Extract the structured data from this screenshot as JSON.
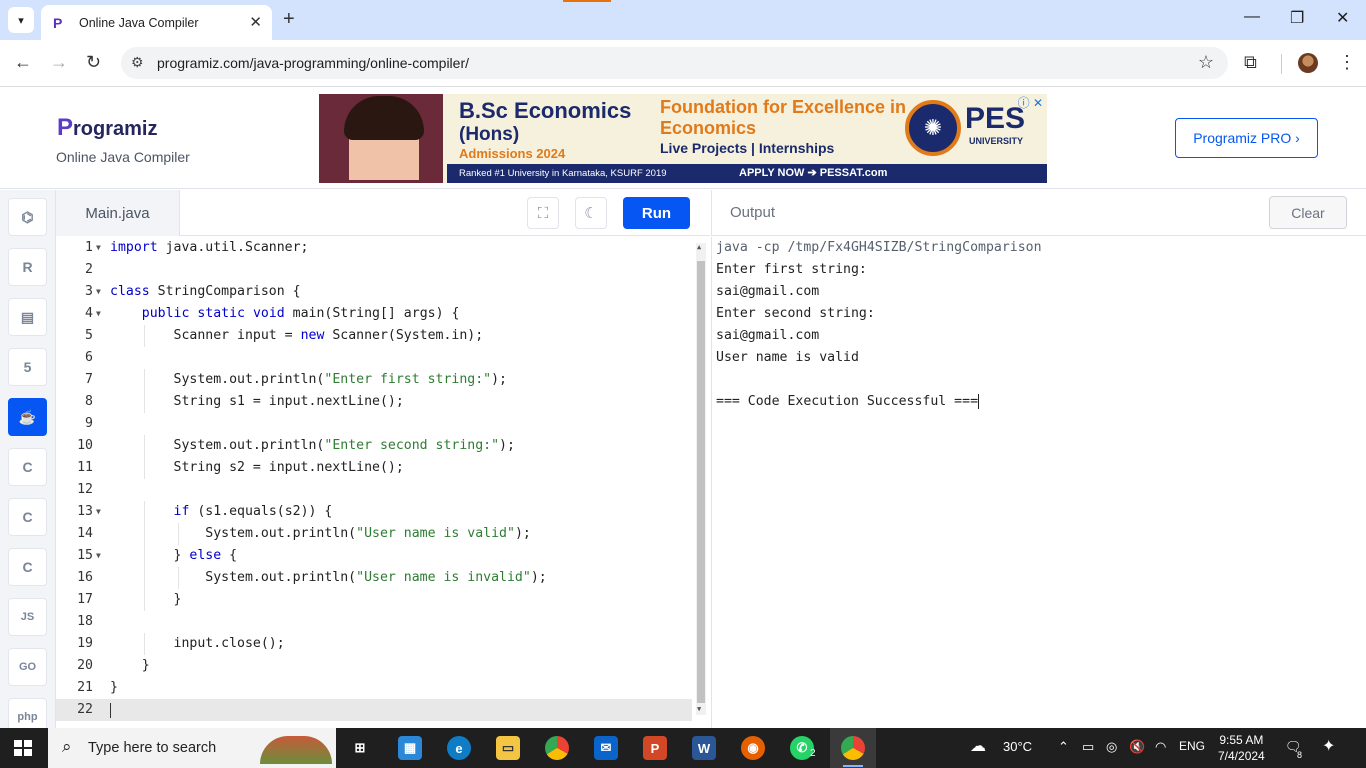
{
  "browser": {
    "tab_title": "Online Java Compiler",
    "url": "programiz.com/java-programming/online-compiler/"
  },
  "site": {
    "logo_first": "P",
    "logo_rest": "rogramiz",
    "subtitle": "Online Java Compiler",
    "pro_button": "Programiz PRO ›"
  },
  "ad": {
    "line1": "B.Sc Economics",
    "line2": "(Hons)",
    "line3": "Admissions 2024",
    "right1": "Foundation for Excellence in Economics",
    "right2": "Live Projects  |  Internships",
    "strip": "Ranked #1 University in Karnataka, KSURF 2019",
    "apply": "APPLY NOW ➔ PESSAT.com",
    "brand": "PES",
    "brand_sub": "UNIVERSITY"
  },
  "editor": {
    "file_name": "Main.java",
    "run_label": "Run",
    "lines": [
      "import java.util.Scanner;",
      "",
      "class StringComparison {",
      "    public static void main(String[] args) {",
      "        Scanner input = new Scanner(System.in);",
      "",
      "        System.out.println(\"Enter first string:\");",
      "        String s1 = input.nextLine();",
      "",
      "        System.out.println(\"Enter second string:\");",
      "        String s2 = input.nextLine();",
      "",
      "        if (s1.equals(s2)) {",
      "            System.out.println(\"User name is valid\");",
      "        } else {",
      "            System.out.println(\"User name is invalid\");",
      "        }",
      "",
      "        input.close();",
      "    }",
      "}",
      ""
    ],
    "fold_lines": [
      1,
      3,
      4,
      13,
      15
    ]
  },
  "output": {
    "title": "Output",
    "clear_label": "Clear",
    "lines": [
      "java -cp /tmp/Fx4GH4SIZB/StringComparison",
      "Enter first string:",
      "sai@gmail.com",
      "Enter second string:",
      "sai@gmail.com",
      "User name is valid",
      "",
      "=== Code Execution Successful ==="
    ]
  },
  "sidebar": {
    "languages": [
      "python",
      "r",
      "sql",
      "html",
      "java",
      "c",
      "cpp",
      "csharp",
      "js",
      "go",
      "php"
    ],
    "labels": {
      "js": "JS",
      "go": "GO",
      "php": "php"
    },
    "active": "java"
  },
  "taskbar": {
    "search_placeholder": "Type here to search",
    "temperature": "30°C",
    "language": "ENG",
    "time": "9:55 AM",
    "date": "7/4/2024",
    "whatsapp_badge": "2",
    "notification_count": "8"
  },
  "colors": {
    "accent": "#0556f3",
    "keyword": "#0000cd",
    "string": "#2e7d32"
  }
}
